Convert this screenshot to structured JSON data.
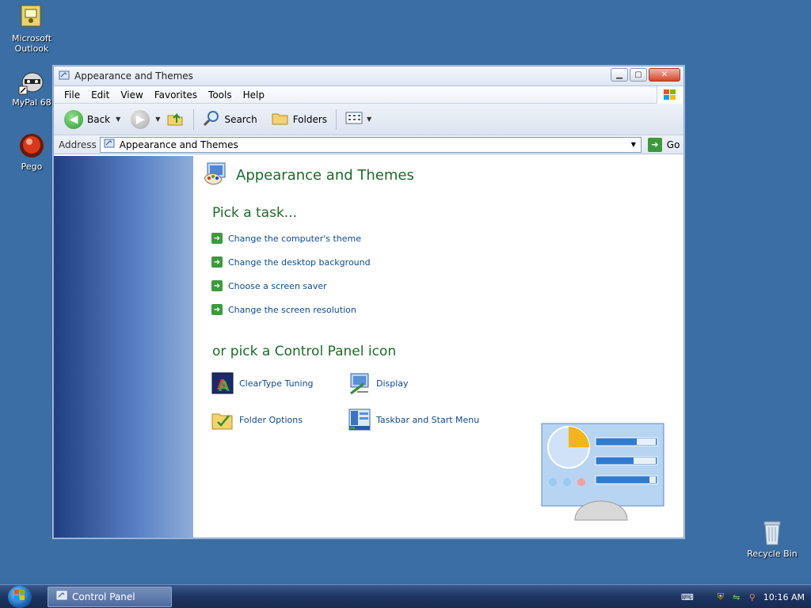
{
  "desktop": {
    "icons": [
      {
        "label": "Microsoft Outlook"
      },
      {
        "label": "MyPal 68"
      },
      {
        "label": "Pego"
      },
      {
        "label": "Recycle Bin"
      }
    ]
  },
  "window": {
    "title": "Appearance and Themes",
    "menu": [
      "File",
      "Edit",
      "View",
      "Favorites",
      "Tools",
      "Help"
    ],
    "toolbar": {
      "back": "Back",
      "search": "Search",
      "folders": "Folders"
    },
    "address": {
      "label": "Address",
      "value": "Appearance and Themes",
      "go": "Go"
    },
    "content": {
      "heading": "Appearance and Themes",
      "pick_task": "Pick a task...",
      "tasks": [
        "Change the computer's theme",
        "Change the desktop background",
        "Choose a screen saver",
        "Change the screen resolution"
      ],
      "pick_icon": "or pick a Control Panel icon",
      "icons": [
        "ClearType Tuning",
        "Display",
        "Folder Options",
        "Taskbar and Start Menu"
      ]
    }
  },
  "taskbar": {
    "task_button": "Control Panel",
    "clock": "10:16 AM"
  },
  "colors": {
    "desktop": "#3a6ea5",
    "heading_green": "#1d6a2a",
    "link_blue": "#0f4a8c"
  }
}
